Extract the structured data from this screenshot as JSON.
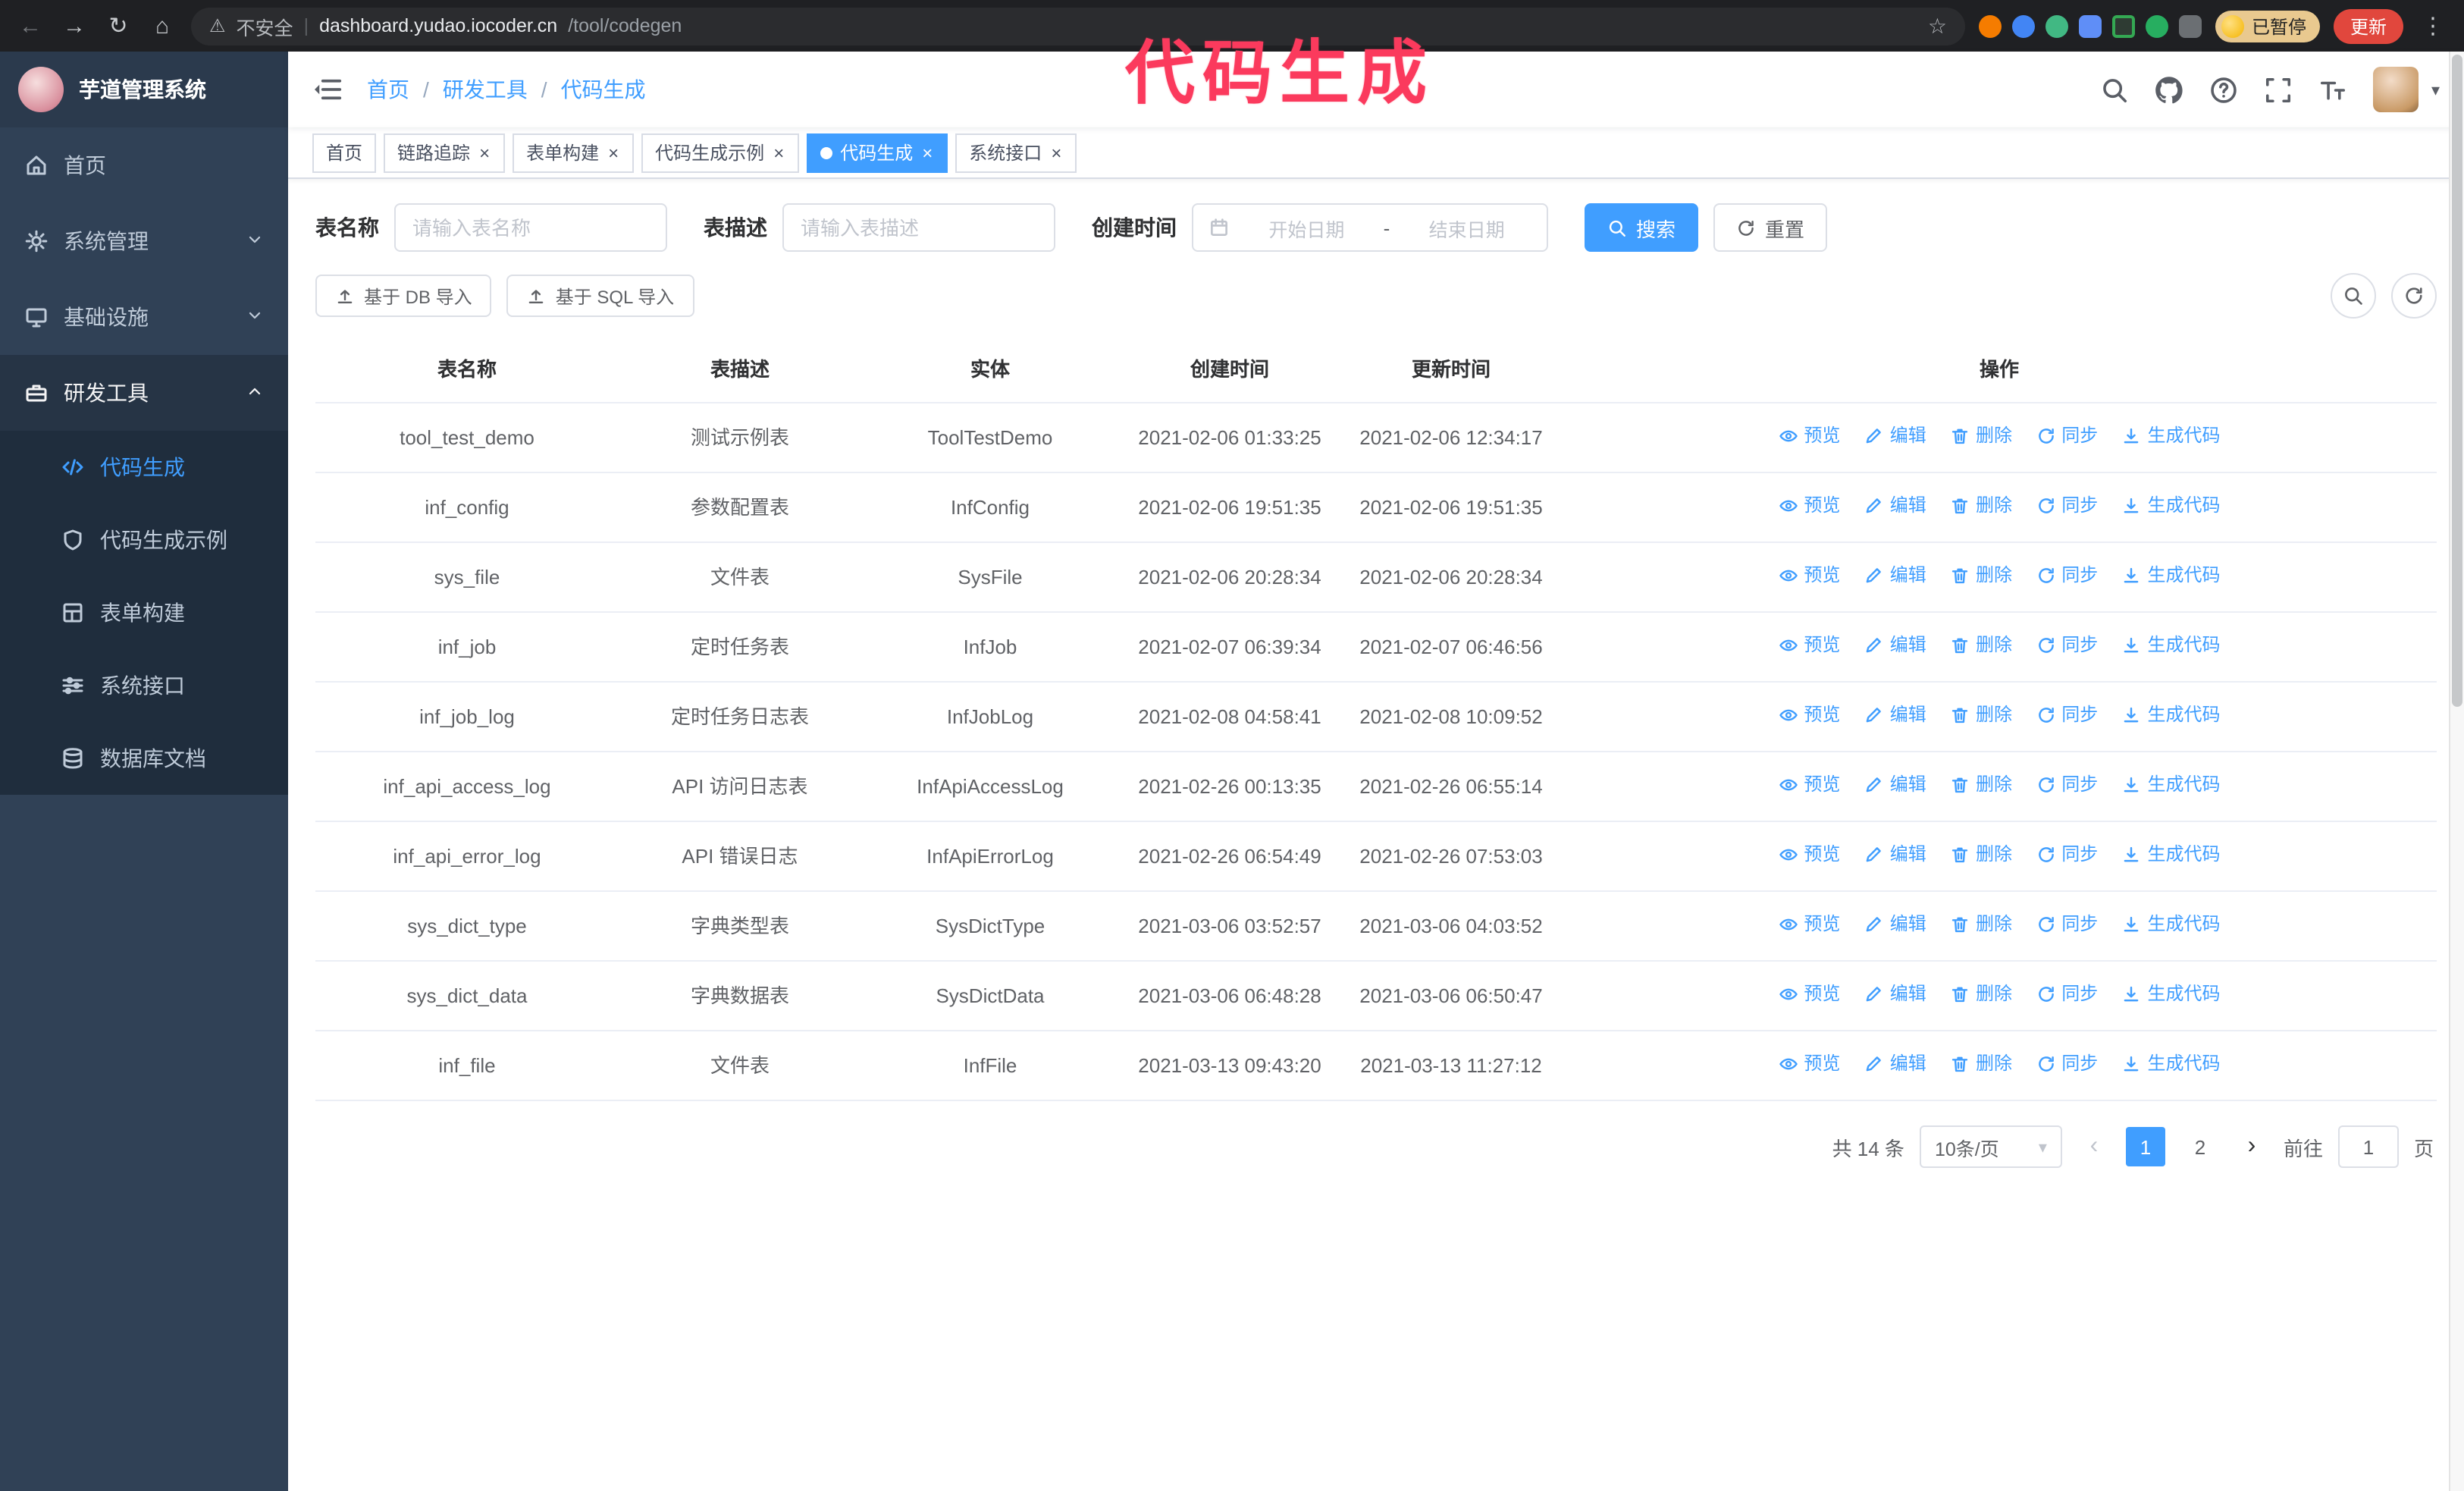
{
  "browser": {
    "security_label": "不安全",
    "url_host": "dashboard.yudao.iocoder.cn",
    "url_path": "/tool/codegen",
    "paused_badge": "已暂停",
    "update_button": "更新"
  },
  "icons": {
    "back": "←",
    "forward": "→",
    "reload": "↻",
    "home": "⌂",
    "warning": "⚠",
    "divider": "|",
    "star": "☆",
    "kebab": "⋮",
    "caret_down": "▾",
    "prev": "‹",
    "next": "›",
    "close": "×"
  },
  "annotation": {
    "text": "代码生成",
    "color": "#fb3a5d"
  },
  "sidebar": {
    "logo_title": "芋道管理系统",
    "items": [
      {
        "label": "首页"
      },
      {
        "label": "系统管理"
      },
      {
        "label": "基础设施"
      },
      {
        "label": "研发工具"
      }
    ],
    "subitems": [
      {
        "label": "代码生成",
        "active": true
      },
      {
        "label": "代码生成示例"
      },
      {
        "label": "表单构建"
      },
      {
        "label": "系统接口"
      },
      {
        "label": "数据库文档"
      }
    ]
  },
  "breadcrumb": {
    "items": [
      "首页",
      "研发工具",
      "代码生成"
    ],
    "separator": "/"
  },
  "tabs": [
    {
      "label": "首页",
      "closable": false,
      "active": false
    },
    {
      "label": "链路追踪",
      "closable": true,
      "active": false
    },
    {
      "label": "表单构建",
      "closable": true,
      "active": false
    },
    {
      "label": "代码生成示例",
      "closable": true,
      "active": false
    },
    {
      "label": "代码生成",
      "closable": true,
      "active": true
    },
    {
      "label": "系统接口",
      "closable": true,
      "active": false
    }
  ],
  "search": {
    "name_label": "表名称",
    "name_placeholder": "请输入表名称",
    "desc_label": "表描述",
    "desc_placeholder": "请输入表描述",
    "time_label": "创建时间",
    "start_placeholder": "开始日期",
    "separator": "-",
    "end_placeholder": "结束日期",
    "search_button": "搜索",
    "reset_button": "重置"
  },
  "toolbar": {
    "import_db_label": "基于 DB 导入",
    "import_sql_label": "基于 SQL 导入"
  },
  "table": {
    "columns": [
      "表名称",
      "表描述",
      "实体",
      "创建时间",
      "更新时间",
      "操作"
    ],
    "action_labels": {
      "preview": "预览",
      "edit": "编辑",
      "delete": "删除",
      "sync": "同步",
      "generate": "生成代码"
    },
    "rows": [
      {
        "name": "tool_test_demo",
        "desc": "测试示例表",
        "entity": "ToolTestDemo",
        "created": "2021-02-06 01:33:25",
        "updated": "2021-02-06 12:34:17"
      },
      {
        "name": "inf_config",
        "desc": "参数配置表",
        "entity": "InfConfig",
        "created": "2021-02-06 19:51:35",
        "updated": "2021-02-06 19:51:35"
      },
      {
        "name": "sys_file",
        "desc": "文件表",
        "entity": "SysFile",
        "created": "2021-02-06 20:28:34",
        "updated": "2021-02-06 20:28:34"
      },
      {
        "name": "inf_job",
        "desc": "定时任务表",
        "entity": "InfJob",
        "created": "2021-02-07 06:39:34",
        "updated": "2021-02-07 06:46:56"
      },
      {
        "name": "inf_job_log",
        "desc": "定时任务日志表",
        "entity": "InfJobLog",
        "created": "2021-02-08 04:58:41",
        "updated": "2021-02-08 10:09:52"
      },
      {
        "name": "inf_api_access_log",
        "desc": "API 访问日志表",
        "entity": "InfApiAccessLog",
        "created": "2021-02-26 00:13:35",
        "updated": "2021-02-26 06:55:14"
      },
      {
        "name": "inf_api_error_log",
        "desc": "API 错误日志",
        "entity": "InfApiErrorLog",
        "created": "2021-02-26 06:54:49",
        "updated": "2021-02-26 07:53:03"
      },
      {
        "name": "sys_dict_type",
        "desc": "字典类型表",
        "entity": "SysDictType",
        "created": "2021-03-06 03:52:57",
        "updated": "2021-03-06 04:03:52"
      },
      {
        "name": "sys_dict_data",
        "desc": "字典数据表",
        "entity": "SysDictData",
        "created": "2021-03-06 06:48:28",
        "updated": "2021-03-06 06:50:47"
      },
      {
        "name": "inf_file",
        "desc": "文件表",
        "entity": "InfFile",
        "created": "2021-03-13 09:43:20",
        "updated": "2021-03-13 11:27:12"
      }
    ]
  },
  "pagination": {
    "total": "共 14 条",
    "page_size": "10条/页",
    "pages": [
      "1",
      "2"
    ],
    "goto_label": "前往",
    "goto_value": "1",
    "goto_unit": "页"
  }
}
